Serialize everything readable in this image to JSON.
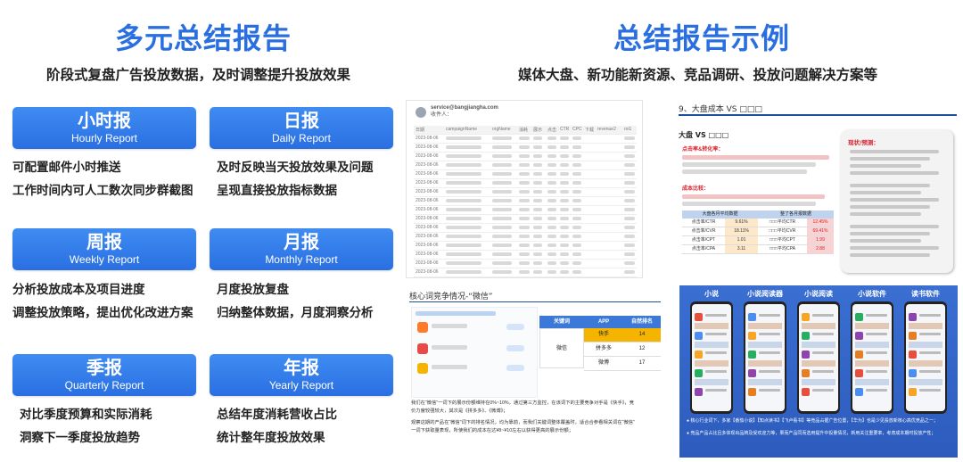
{
  "left_title": "多元总结报告",
  "left_subtitle": "阶段式复盘广告投放数据，及时调整提升投放效果",
  "right_title": "总结报告示例",
  "right_subtitle": "媒体大盘、新功能新资源、竞品调研、投放问题解决方案等",
  "reports": [
    {
      "zh": "小时报",
      "en": "Hourly Report",
      "desc": [
        "可配置邮件小时推送",
        "工作时间内可人工数次同步群截图"
      ]
    },
    {
      "zh": "日报",
      "en": "Daily Report",
      "desc": [
        "及时反映当天投放效果及问题",
        "呈现直接投放指标数据"
      ]
    },
    {
      "zh": "周报",
      "en": "Weekly Report",
      "desc": [
        "分析投放成本及项目进度",
        "调整投放策略，提出优化改进方案"
      ]
    },
    {
      "zh": "月报",
      "en": "Monthly Report",
      "desc": [
        "月度投放复盘",
        "归纳整体数据，月度洞察分析"
      ]
    },
    {
      "zh": "季报",
      "en": "Quarterly Report",
      "desc": [
        "对比季度预算和实际消耗",
        "洞察下一季度投放趋势"
      ]
    },
    {
      "zh": "年报",
      "en": "Yearly Report",
      "desc": [
        "总结年度消耗营收占比",
        "统计整年度投放效果"
      ]
    }
  ],
  "thumb1": {
    "email": "service@bangjiangha.com",
    "to": "收件人：",
    "headers": [
      "日期",
      "campaignName",
      "orgName",
      "消耗",
      "展示",
      "点击",
      "CTR",
      "CPC",
      "下载",
      "revenue2",
      "roi1"
    ],
    "dates": [
      "2023-08-06",
      "2023-08-06",
      "2023-08-06",
      "2023-08-06",
      "2023-08-06",
      "2023-08-06",
      "2023-08-06",
      "2023-08-06",
      "2023-08-06",
      "2023-08-06",
      "2023-08-06",
      "2023-08-06",
      "2023-08-06",
      "2023-08-06",
      "2023-08-06",
      "2023-08-06",
      "2023-08-06",
      "2023-08-06"
    ]
  },
  "thumb2": {
    "heading": "9、大盘成本 VS □□□",
    "sub": "大盘 VS □□□",
    "p1_label": "点击率&转化率：",
    "p2_label": "成本比较：",
    "box_title": "现状/预测：",
    "table_head_left": "大盘各月平均数据",
    "table_head_right": "整了各月报数据",
    "rows": [
      {
        "k": "点击率/CTR",
        "v": "9.61%",
        "k2": "□□□平均CTR",
        "v2": "12.45%"
      },
      {
        "k": "点击率/CVR",
        "v": "18.11%",
        "k2": "□□□平均CVR",
        "v2": "69.41%"
      },
      {
        "k": "点击率/CPT",
        "v": "1.01",
        "k2": "□□□平均CPT",
        "v2": "1.99"
      },
      {
        "k": "点击率/CPA",
        "v": "3.11",
        "k2": "□□□平均CPA",
        "v2": "2.88"
      }
    ]
  },
  "thumb3": {
    "heading": "核心词竞争情况-“微信”",
    "table_headers": [
      "关键词",
      "APP",
      "自然排名"
    ],
    "keyword": "微信",
    "apps": [
      {
        "name": "快手",
        "rank": "14"
      },
      {
        "name": "拼多多",
        "rank": "12"
      },
      {
        "name": "微博",
        "rank": "17"
      }
    ],
    "line1": "我们在“微信”一词下的展示份额维持在0%~10%，通过第三方监控，在该词下的主要竞争对手是《快手》，竞",
    "line2": "价力度较强较大，其次是《拼多多》、《微博》；",
    "line3": "观察这期的产品在“微信”词下的排名情况，均为靠前，而我们关键词整体覆盖时，适合合参看相关词在“微信”",
    "line4": "一词下获取量表现，所使我们的成本在达¥8~¥10左右以获得更高的展示份额；"
  },
  "thumb4": {
    "labels": [
      "小说",
      "小说阅读器",
      "小说阅读",
      "小说软件",
      "读书软件"
    ],
    "note1": "● 核心行业词下，多家【番茄小说】【知点读书】【飞卢看书】等竞品占据广告位置，【华为】也是少见投放新核心高优竞品之一；",
    "note2": "● 竞品产品占比且多体现出品牌及受欢迎力等，果而产品同而选用提升中投量情况，新用关注重要率，考虑成本期时投放产性；"
  }
}
